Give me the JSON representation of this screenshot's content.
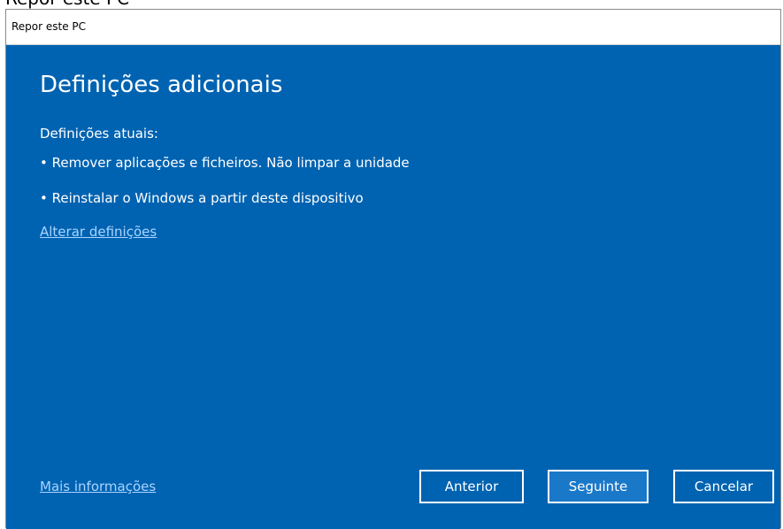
{
  "background_window": {
    "title_fragment": "Repor este PC"
  },
  "dialog": {
    "title": "Repor este PC",
    "heading": "Definições adicionais",
    "current_settings_label": "Definições atuais:",
    "settings": [
      "• Remover aplicações e ficheiros. Não limpar a unidade",
      "•  Reinstalar o Windows a partir deste dispositivo"
    ],
    "change_settings_link": "Alterar definições",
    "more_info_link": "Mais informações",
    "buttons": {
      "back": "Anterior",
      "next": "Seguinte",
      "cancel": "Cancelar"
    },
    "colors": {
      "background": "#0063b1",
      "link": "#a9d4ff",
      "text": "#ffffff"
    }
  }
}
